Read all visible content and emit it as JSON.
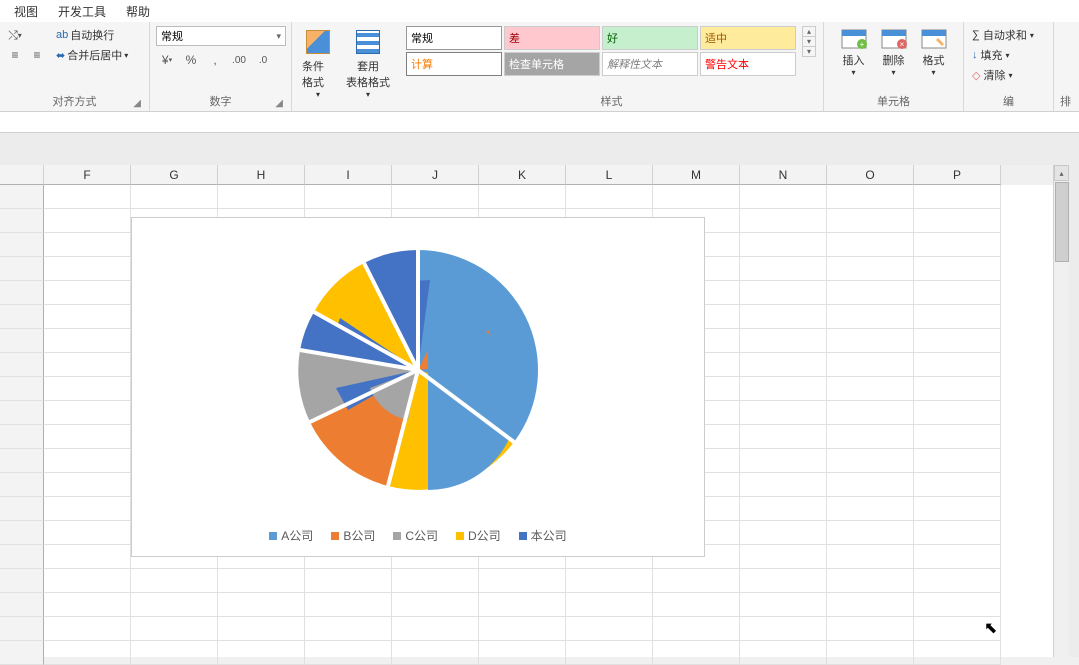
{
  "menu": {
    "view": "视图",
    "dev": "开发工具",
    "help": "帮助"
  },
  "ribbon": {
    "align": {
      "wrap": "自动换行",
      "merge": "合并后居中",
      "label": "对齐方式"
    },
    "number": {
      "format": "常规",
      "label": "数字"
    },
    "cond": {
      "label": "条件格式"
    },
    "table": {
      "label": "套用\n表格格式"
    },
    "styles": {
      "normal": "常规",
      "bad": "差",
      "good": "好",
      "mid": "适中",
      "calc": "计算",
      "check": "检查单元格",
      "expl": "解释性文本",
      "warn": "警告文本",
      "label": "样式"
    },
    "cells": {
      "insert": "插入",
      "delete": "删除",
      "format": "格式",
      "label": "单元格"
    },
    "editing": {
      "sum": "自动求和",
      "fill": "填充",
      "clear": "清除",
      "label": "编"
    },
    "sort": "排"
  },
  "columns": [
    "F",
    "G",
    "H",
    "I",
    "J",
    "K",
    "L",
    "M",
    "N",
    "O",
    "P"
  ],
  "chart_data": {
    "type": "pie",
    "title": "",
    "series": [
      {
        "name": "A公司",
        "color": "#5b9bd5",
        "values": [
          12,
          10,
          8,
          15,
          38
        ]
      },
      {
        "name": "B公司",
        "color": "#ed7d31",
        "values": [
          4,
          3,
          6,
          12,
          0
        ]
      },
      {
        "name": "C公司",
        "color": "#a5a5a5",
        "values": [
          0,
          6,
          8,
          0,
          0
        ]
      },
      {
        "name": "D公司",
        "color": "#ffc000",
        "values": [
          8,
          6,
          20,
          0,
          0
        ]
      },
      {
        "name": "本公司",
        "color": "#4472c4",
        "values": [
          10,
          10,
          18,
          0,
          0
        ]
      }
    ],
    "note": "Nested/overlaid pie with 5 series"
  },
  "legend": {
    "a": "A公司",
    "b": "B公司",
    "c": "C公司",
    "d": "D公司",
    "e": "本公司"
  }
}
